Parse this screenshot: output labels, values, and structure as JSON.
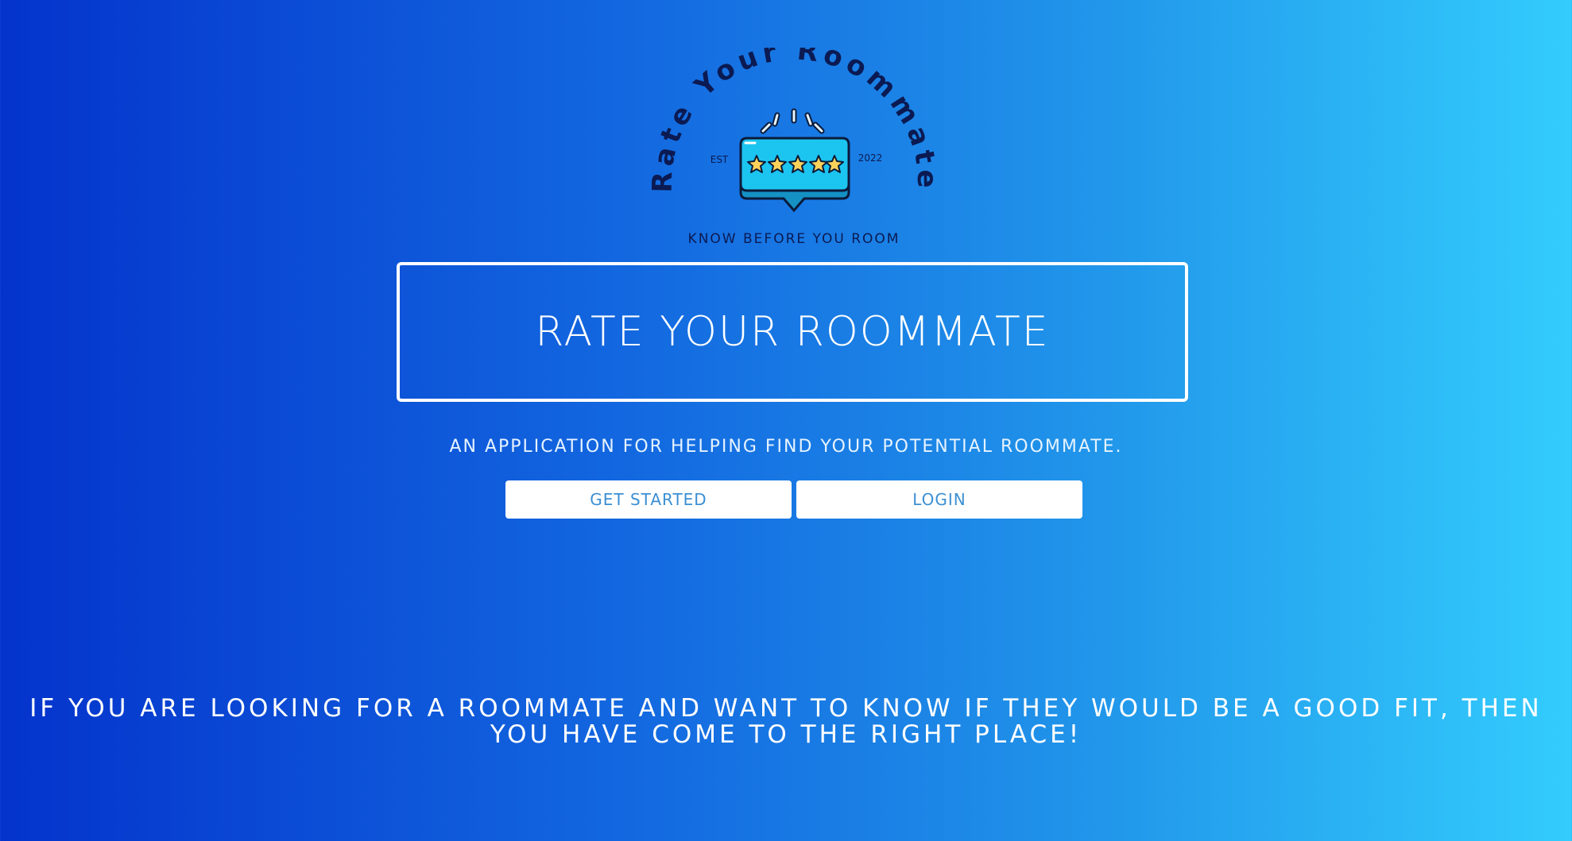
{
  "logo": {
    "arc_text": "Rate Your Roommate",
    "est_label": "EST",
    "year_label": "2022",
    "motto": "KNOW BEFORE YOU ROOM",
    "star_count": 5,
    "colors": {
      "text": "#0b1a52",
      "bubble": "#1cc4f0",
      "star": "#fdd25a",
      "outline": "#0b1a3a"
    }
  },
  "hero": {
    "title": "RATE YOUR ROOMMATE"
  },
  "subtitle": "AN APPLICATION FOR HELPING FIND YOUR POTENTIAL ROOMMATE.",
  "buttons": {
    "get_started": "GET STARTED",
    "login": "LOGIN"
  },
  "tagline": "IF YOU ARE LOOKING FOR A ROOMMATE AND WANT TO KNOW IF THEY WOULD BE A GOOD FIT, THEN YOU HAVE COME TO THE RIGHT PLACE!",
  "theme": {
    "gradient_start": "#0433cc",
    "gradient_end": "#33ccfd",
    "button_text": "#3b8fd3"
  }
}
